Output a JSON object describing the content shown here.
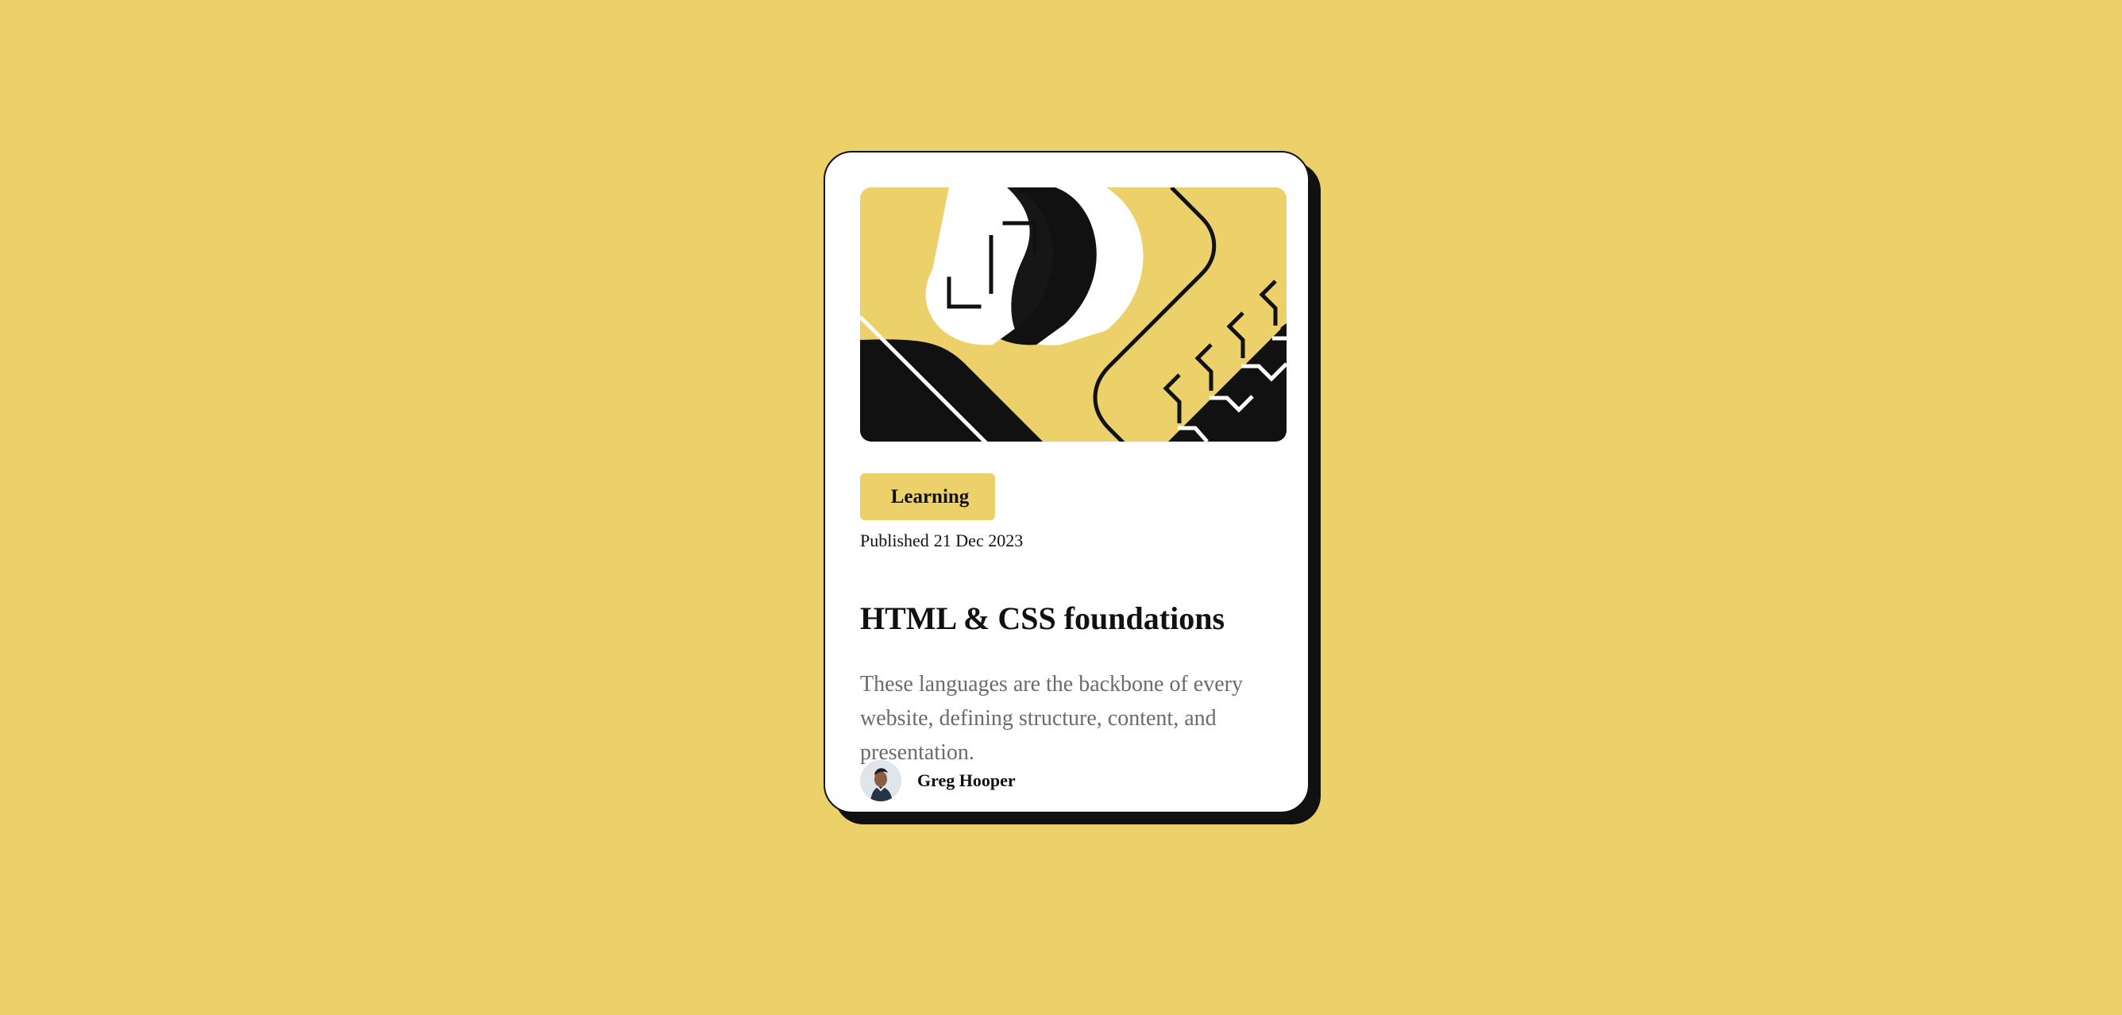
{
  "card": {
    "tag_label": "Learning",
    "published_label": "Published",
    "published_date": "21 Dec 2023",
    "title": "HTML & CSS foundations",
    "excerpt": "These languages are the backbone of every website, defining structure, content, and presentation.",
    "author": {
      "name": "Greg Hooper",
      "avatar_icon": "user-avatar-icon"
    }
  },
  "illustration": {
    "icon": "abstract-code-illustration",
    "colors": {
      "yellow": "#ECD16A",
      "black": "#111111",
      "white": "#FFFFFF"
    }
  },
  "theme": {
    "background": "#ECD16A",
    "card_background": "#FFFFFF",
    "text": "#111111",
    "muted_text": "#6B6B6B"
  }
}
